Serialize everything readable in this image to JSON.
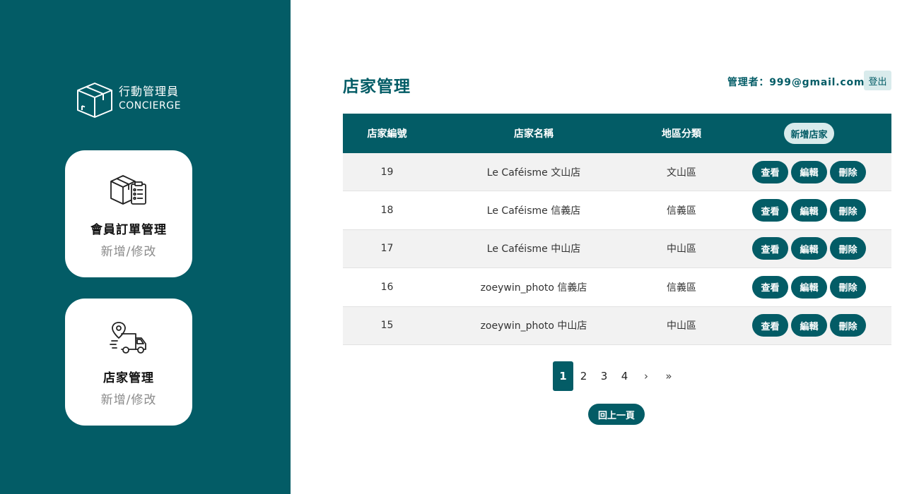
{
  "sidebar": {
    "logo": {
      "zh": "行動管理員",
      "en": "CONCIERGE"
    },
    "cards": [
      {
        "title": "會員訂單管理",
        "sub": "新增/修改",
        "icon": "box-checklist-icon"
      },
      {
        "title": "店家管理",
        "sub": "新增/修改",
        "icon": "delivery-truck-icon"
      }
    ]
  },
  "header": {
    "title": "店家管理",
    "admin": "管理者：999@gmail.com",
    "logout": "登出"
  },
  "table": {
    "headers": [
      "店家編號",
      "店家名稱",
      "地區分類"
    ],
    "add_label": "新增店家",
    "rows": [
      {
        "id": "19",
        "name": "Le Caféisme 文山店",
        "area": "文山區"
      },
      {
        "id": "18",
        "name": "Le Caféisme 信義店",
        "area": "信義區"
      },
      {
        "id": "17",
        "name": "Le Caféisme 中山店",
        "area": "中山區"
      },
      {
        "id": "16",
        "name": "zoeywin_photo 信義店",
        "area": "信義區"
      },
      {
        "id": "15",
        "name": "zoeywin_photo 中山店",
        "area": "中山區"
      }
    ],
    "actions": {
      "view": "查看",
      "edit": "編輯",
      "delete": "刪除"
    }
  },
  "pagination": {
    "pages": [
      "1",
      "2",
      "3",
      "4"
    ],
    "current": "1",
    "next": "›",
    "last": "»"
  },
  "back_label": "回上一頁",
  "colors": {
    "primary": "#035c66",
    "light": "#d9ebec"
  }
}
